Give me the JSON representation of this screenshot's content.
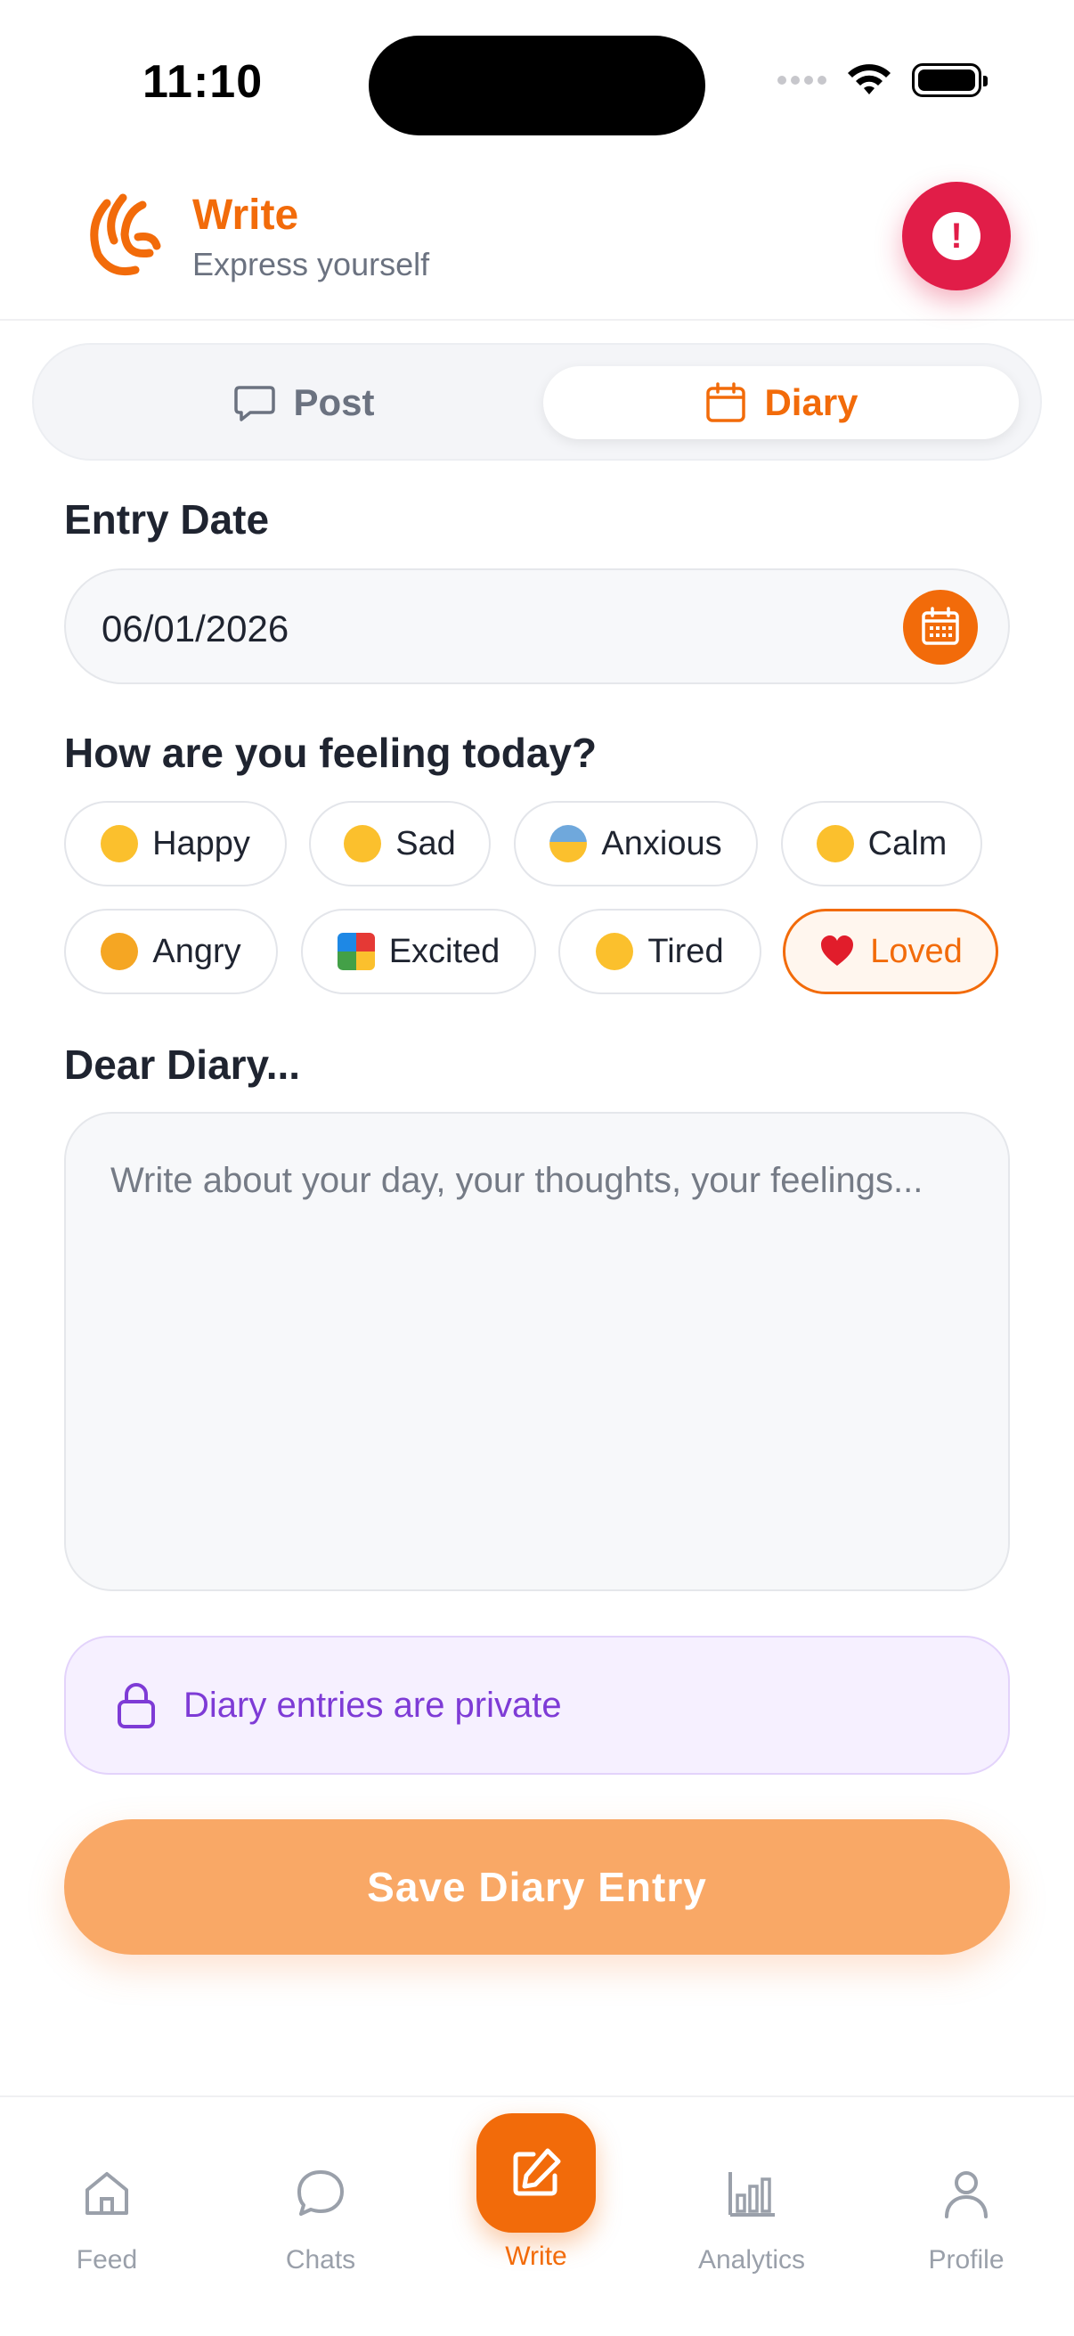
{
  "status_bar": {
    "time": "11:10"
  },
  "header": {
    "title": "Write",
    "subtitle": "Express yourself"
  },
  "tabs": [
    {
      "label": "Post",
      "active": false
    },
    {
      "label": "Diary",
      "active": true
    }
  ],
  "entry_date": {
    "label": "Entry Date",
    "value": "06/01/2026"
  },
  "mood": {
    "label": "How are you feeling today?",
    "options": [
      {
        "label": "Happy",
        "emoji": "smiling-face-icon",
        "selected": false
      },
      {
        "label": "Sad",
        "emoji": "pensive-face-icon",
        "selected": false
      },
      {
        "label": "Anxious",
        "emoji": "anxious-face-icon",
        "selected": false
      },
      {
        "label": "Calm",
        "emoji": "relieved-face-icon",
        "selected": false
      },
      {
        "label": "Angry",
        "emoji": "angry-face-icon",
        "selected": false
      },
      {
        "label": "Excited",
        "emoji": "party-popper-icon",
        "selected": false
      },
      {
        "label": "Tired",
        "emoji": "sleeping-face-icon",
        "selected": false
      },
      {
        "label": "Loved",
        "emoji": "red-heart-icon",
        "selected": true
      }
    ]
  },
  "diary": {
    "label": "Dear Diary...",
    "placeholder": "Write about your day, your thoughts, your feelings...",
    "value": ""
  },
  "privacy_note": "Diary entries are private",
  "save_label": "Save Diary Entry",
  "nav": [
    {
      "label": "Feed",
      "icon": "home-icon"
    },
    {
      "label": "Chats",
      "icon": "chat-bubble-icon"
    },
    {
      "label": "Write",
      "icon": "edit-icon",
      "active": true
    },
    {
      "label": "Analytics",
      "icon": "bar-chart-icon"
    },
    {
      "label": "Profile",
      "icon": "user-icon"
    }
  ],
  "colors": {
    "accent": "#f26b0a",
    "alert": "#e11d48",
    "private_text": "#7e3bd6",
    "save_button": "#f9a866"
  }
}
